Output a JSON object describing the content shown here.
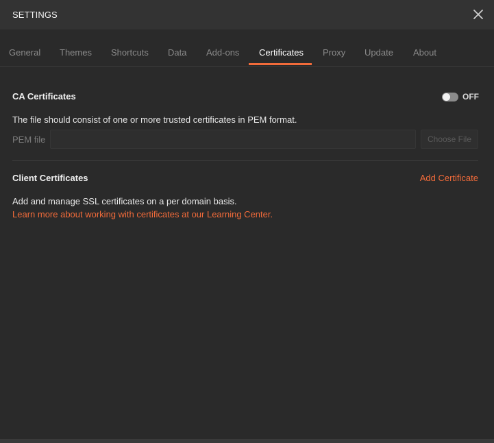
{
  "header": {
    "title": "SETTINGS",
    "close_icon": "close-icon"
  },
  "tabs": [
    {
      "label": "General",
      "active": false
    },
    {
      "label": "Themes",
      "active": false
    },
    {
      "label": "Shortcuts",
      "active": false
    },
    {
      "label": "Data",
      "active": false
    },
    {
      "label": "Add-ons",
      "active": false
    },
    {
      "label": "Certificates",
      "active": true
    },
    {
      "label": "Proxy",
      "active": false
    },
    {
      "label": "Update",
      "active": false
    },
    {
      "label": "About",
      "active": false
    }
  ],
  "ca_certificates": {
    "title": "CA Certificates",
    "toggle_state": "OFF",
    "toggle_on": false,
    "description": "The file should consist of one or more trusted certificates in PEM format.",
    "pem_label": "PEM file",
    "pem_value": "",
    "choose_file_label": "Choose File"
  },
  "client_certificates": {
    "title": "Client Certificates",
    "add_label": "Add Certificate",
    "description": "Add and manage SSL certificates on a per domain basis.",
    "learn_more": "Learn more about working with certificates at our Learning Center."
  },
  "colors": {
    "accent": "#f26b3a",
    "background": "#2a2a2a",
    "header": "#333333"
  }
}
